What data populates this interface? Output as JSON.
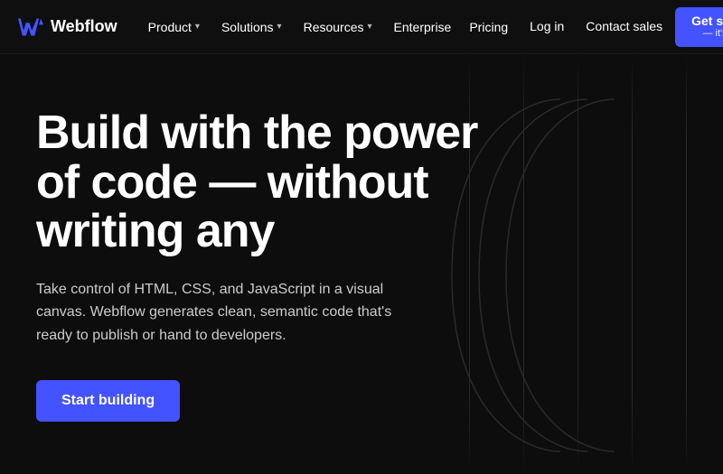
{
  "nav": {
    "logo_text": "Webflow",
    "items": [
      {
        "label": "Product",
        "has_dropdown": true
      },
      {
        "label": "Solutions",
        "has_dropdown": true
      },
      {
        "label": "Resources",
        "has_dropdown": true
      },
      {
        "label": "Enterprise",
        "has_dropdown": false
      }
    ],
    "pricing_label": "Pricing",
    "login_label": "Log in",
    "contact_label": "Contact sales",
    "cta_label": "Get started",
    "cta_sublabel": "— it's free"
  },
  "hero": {
    "title": "Build with the power of code — without writing any",
    "subtitle": "Take control of HTML, CSS, and JavaScript in a visual canvas. Webflow generates clean, semantic code that's ready to publish or hand to developers.",
    "cta_label": "Start building"
  }
}
